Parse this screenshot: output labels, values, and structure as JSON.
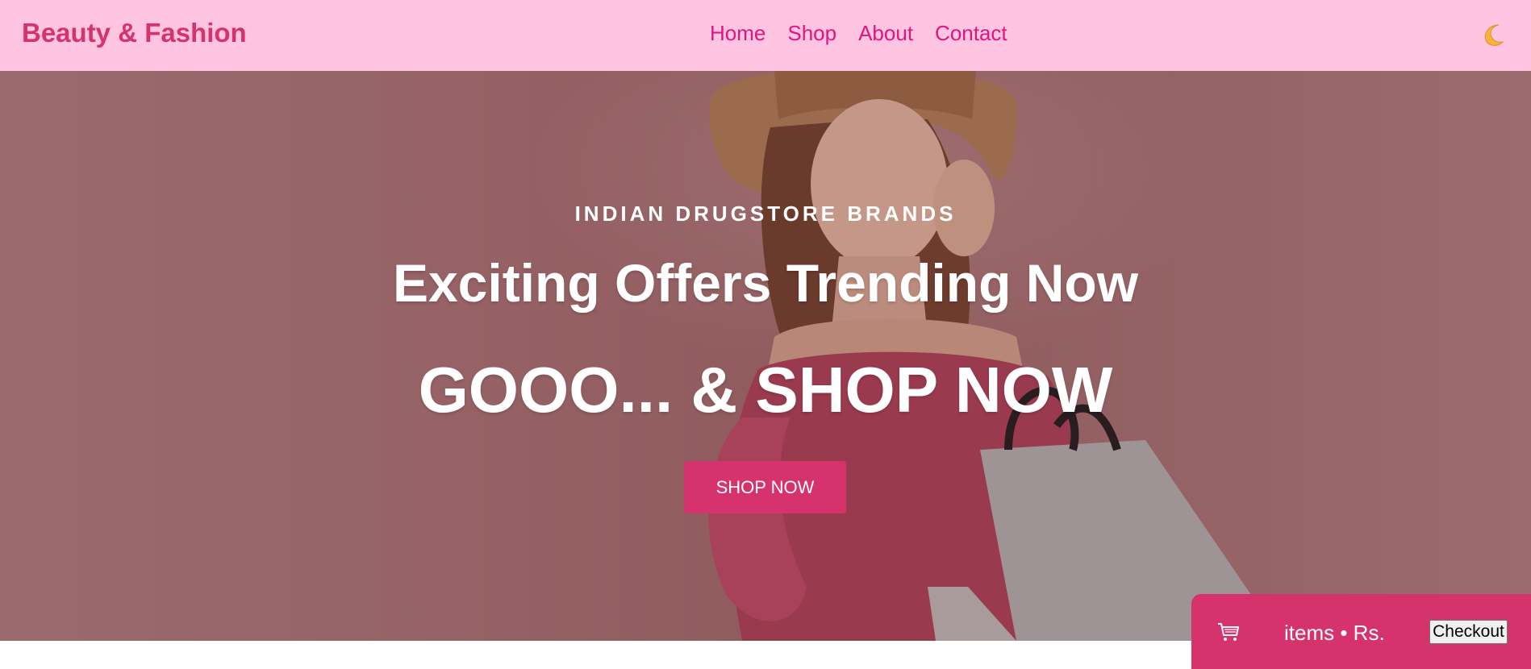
{
  "header": {
    "brand": "Beauty & Fashion",
    "nav": [
      {
        "label": "Home"
      },
      {
        "label": "Shop"
      },
      {
        "label": "About"
      },
      {
        "label": "Contact"
      }
    ],
    "theme_toggle_icon": "crescent-moon-icon"
  },
  "hero": {
    "eyebrow": "INDIAN DRUGSTORE BRANDS",
    "title": "Exciting Offers Trending Now",
    "headline": "GOOO... & SHOP NOW",
    "cta_label": "SHOP NOW",
    "background_image": "woman-with-shopping-bag-photo"
  },
  "cart": {
    "icon": "cart-icon",
    "summary": "items • Rs.",
    "checkout_label": "Checkout"
  },
  "colors": {
    "accent": "#d6336c",
    "nav_link": "#e0157d",
    "header_bg": "#ffc4e1",
    "hero_overlay": "#96616a"
  }
}
